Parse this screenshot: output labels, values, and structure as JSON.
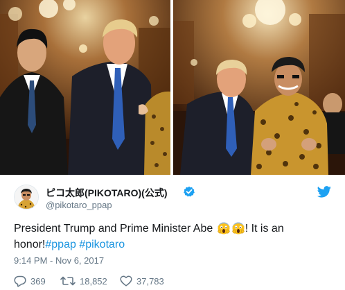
{
  "tweet": {
    "display_name": "ピコ太郎(PIKOTARO)(公式)",
    "screen_name": "@pikotaro_ppap",
    "text_line1": "President Trump and Prime Minister Abe",
    "text_line1_tail": "! It is an",
    "text_line2_prefix": "honor!",
    "hashtag1": "#ppap",
    "hashtag2": "#pikotaro",
    "timestamp": "9:14 PM - Nov 6, 2017",
    "verified": true,
    "icons": {
      "verified": "verified-badge-icon",
      "bird": "twitter-bird-icon",
      "reply": "reply-icon",
      "retweet": "retweet-icon",
      "like": "heart-icon",
      "emoji": "face-screaming-in-fear-emoji"
    }
  },
  "actions": {
    "replies": "369",
    "retweets": "18,852",
    "likes": "37,783"
  },
  "colors": {
    "text": "#14171a",
    "secondary": "#657786",
    "link": "#1b95e0",
    "verified": "#1da1f2",
    "bird": "#1da1f2"
  }
}
